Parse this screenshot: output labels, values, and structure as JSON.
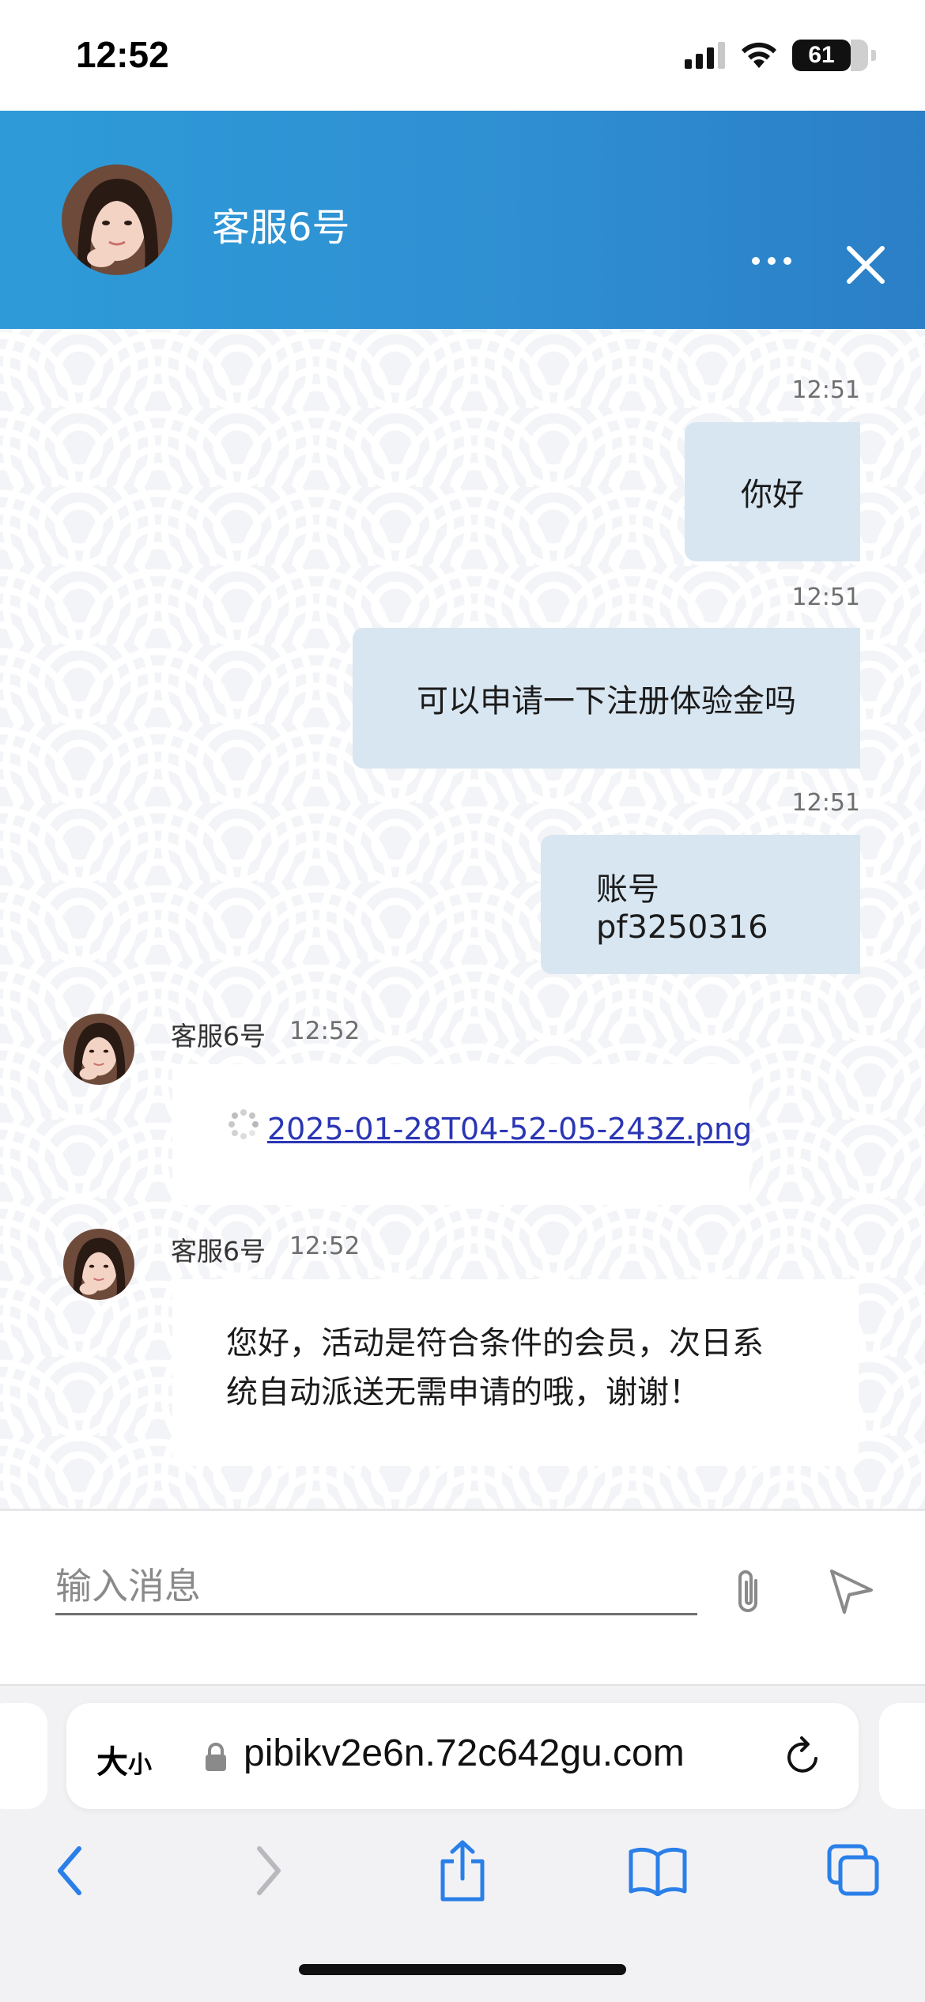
{
  "status_bar": {
    "time": "12:52",
    "battery": "61"
  },
  "header": {
    "agent_name": "客服6号"
  },
  "messages": {
    "out": [
      {
        "time": "12:51",
        "text": "你好"
      },
      {
        "time": "12:51",
        "text": "可以申请一下注册体验金吗"
      },
      {
        "time": "12:51",
        "text": "账号pf3250316"
      }
    ],
    "in": [
      {
        "name": "客服6号",
        "time": "12:52",
        "file": "2025-01-28T04-52-05-243Z.png"
      },
      {
        "name": "客服6号",
        "time": "12:52",
        "text_line1": "您好，活动是符合条件的会员，次日系",
        "text_line2": "统自动派送无需申请的哦，谢谢！"
      }
    ]
  },
  "input": {
    "placeholder": "输入消息"
  },
  "browser": {
    "text_size_big": "大",
    "text_size_small": "小",
    "url": "pibikv2e6n.72c642gu.com"
  },
  "colors": {
    "header": "#2f8fd2",
    "bubble_out": "#d8e6f1",
    "bubble_in": "#ffffff",
    "link": "#2a36b4",
    "safari_blue": "#2a7fe8"
  },
  "icons": {
    "more": "ellipsis-icon",
    "close": "close-icon",
    "attach": "paperclip-icon",
    "send": "send-icon",
    "lock": "lock-icon",
    "reload": "reload-icon",
    "back": "chevron-left-icon",
    "forward": "chevron-right-icon",
    "share": "share-icon",
    "bookmarks": "book-icon",
    "tabs": "tabs-icon"
  }
}
